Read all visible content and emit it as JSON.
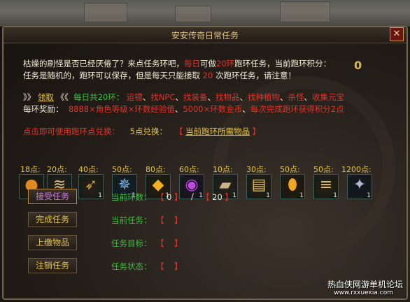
{
  "title": "安安传奇日常任务",
  "close_icon": "close-icon",
  "intro": {
    "line1_a": "枯燥的刷怪是否已经厌倦了？来点任务环吧，",
    "line1_daily": "每日",
    "line1_b": "可做",
    "line1_num": "20环",
    "line1_c": "跑环任务，当前跑环积分：",
    "score": "0",
    "line2_a": "任务是随机的，跑环可以保存，但是每天只能接取",
    "line2_num": "20",
    "line2_b": "次跑环任务，请注意！"
  },
  "claim": {
    "prefix": "》》",
    "link": "领取",
    "suffix": "《《",
    "total": "每日共20环：",
    "types": [
      "运镖",
      "找NPC",
      "找装备",
      "找物品",
      "找种植物",
      "杀怪",
      "收集元宝"
    ]
  },
  "reward": {
    "label": "每环奖励：",
    "exp": "8888×角色等级×环数经验值",
    "gold": "5000×环数金币",
    "bonus": "每次完成跑环获得积分2点"
  },
  "exchange": {
    "hint": "点击即可使用跑环点兑换：",
    "cost": "5点兑换：",
    "open": "【",
    "link": "当前跑环所需物品",
    "close": "】"
  },
  "items": [
    {
      "points": "18点:",
      "icon": "orb-icon",
      "qty": "1"
    },
    {
      "points": "20点:",
      "icon": "scroll-icon",
      "qty": "1"
    },
    {
      "points": "40点:",
      "icon": "horn-icon",
      "qty": "1"
    },
    {
      "points": "50点:",
      "icon": "crest-icon",
      "qty": "1"
    },
    {
      "points": "80点:",
      "icon": "gold-gem-icon",
      "qty": "1"
    },
    {
      "points": "60点:",
      "icon": "purple-orb-icon",
      "qty": "1"
    },
    {
      "points": "10点:",
      "icon": "book-icon",
      "qty": "1"
    },
    {
      "points": "30点:",
      "icon": "tome-icon",
      "qty": "1"
    },
    {
      "points": "50点:",
      "icon": "golden-egg-icon",
      "qty": "1"
    },
    {
      "points": "50点:",
      "icon": "scroll-bundle-icon",
      "qty": "1"
    },
    {
      "points": "1200点:",
      "icon": "relic-icon",
      "qty": "1"
    }
  ],
  "actions": {
    "accept": "接受任务",
    "complete": "完成任务",
    "submit": "上缴物品",
    "cancel": "注销任务"
  },
  "status": {
    "ring_label": "当前环数：",
    "ring_current": "0",
    "ring_sep": "/",
    "ring_total": "20",
    "open": "【",
    "close": "】",
    "task_label": "当前任务：",
    "target_label": "任务目标：",
    "state_label": "任务状态："
  },
  "watermark": {
    "line1": "热血侠网游单机论坛",
    "line2": "www.rxxuexia.com"
  },
  "colors": {
    "gold": "#e3c44e",
    "red": "#e0332a",
    "orange": "#e8892a",
    "green": "#3fbf3f"
  }
}
